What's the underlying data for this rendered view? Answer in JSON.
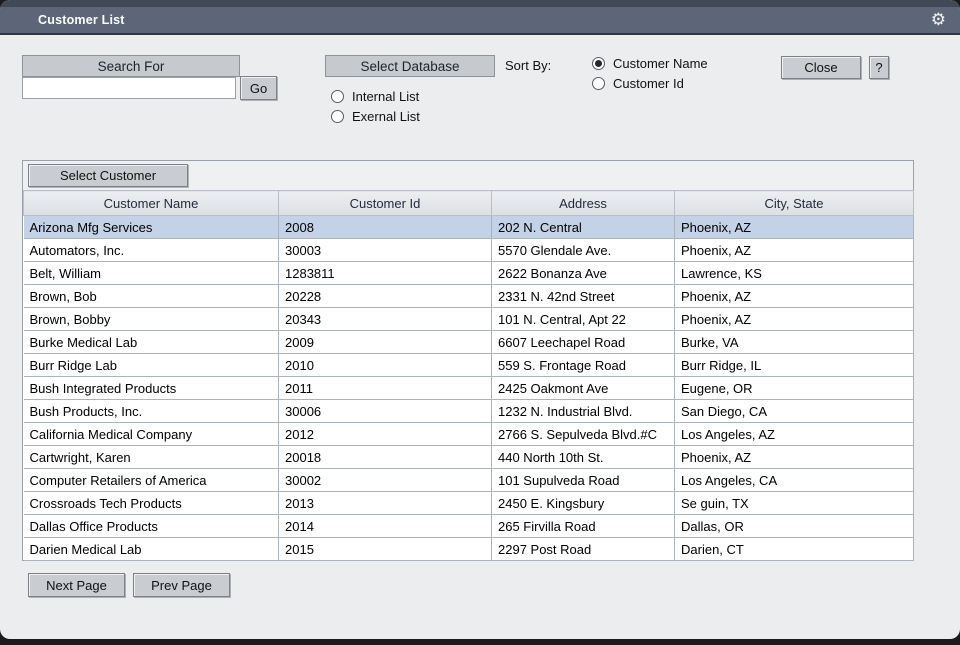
{
  "window": {
    "title": "Customer List"
  },
  "icons": {
    "titlebar_right": "gear-icon",
    "gear_glyph": "⚙"
  },
  "colors": {
    "titlebar": "#5c6678",
    "titlebar_top_strip": "#414956",
    "body_bg": "#ebedef",
    "selected_row": "#c4d2e7",
    "header_bar": "#c6c9cd",
    "outer_bg": "#1b1b1b"
  },
  "search": {
    "header": "Search For",
    "value": "",
    "go_label": "Go"
  },
  "database": {
    "header": "Select Database",
    "options": [
      {
        "label": "Internal List",
        "selected": false
      },
      {
        "label": "Exernal List",
        "selected": false
      }
    ]
  },
  "sort": {
    "label": "Sort By:",
    "options": [
      {
        "label": "Customer Name",
        "selected": true
      },
      {
        "label": "Customer Id",
        "selected": false
      }
    ]
  },
  "actions": {
    "close": "Close",
    "help": "?",
    "select_customer": "Select Customer",
    "next_page": "Next Page",
    "prev_page": "Prev Page"
  },
  "table": {
    "columns": [
      "Customer Name",
      "Customer Id",
      "Address",
      "City, State"
    ],
    "selected_row_index": 0,
    "rows": [
      [
        "Arizona Mfg Services",
        "2008",
        "202 N. Central",
        "Phoenix, AZ"
      ],
      [
        "Automators, Inc.",
        "30003",
        "5570 Glendale Ave.",
        "Phoenix, AZ"
      ],
      [
        "Belt, William",
        "1283811",
        "2622 Bonanza Ave",
        "Lawrence, KS"
      ],
      [
        "Brown, Bob",
        "20228",
        "2331 N. 42nd Street",
        "Phoenix, AZ"
      ],
      [
        "Brown, Bobby",
        "20343",
        "101 N. Central, Apt 22",
        "Phoenix, AZ"
      ],
      [
        "Burke Medical Lab",
        "2009",
        "6607 Leechapel Road",
        "Burke, VA"
      ],
      [
        "Burr Ridge Lab",
        "2010",
        "559 S. Frontage Road",
        "Burr Ridge, IL"
      ],
      [
        "Bush Integrated Products",
        "2011",
        "2425 Oakmont Ave",
        "Eugene, OR"
      ],
      [
        "Bush Products, Inc.",
        "30006",
        "1232 N. Industrial Blvd.",
        "San Diego, CA"
      ],
      [
        "California Medical Company",
        "2012",
        "2766 S. Sepulveda Blvd.#C",
        "Los Angeles, AZ"
      ],
      [
        "Cartwright, Karen",
        "20018",
        "440 North 10th St.",
        "Phoenix, AZ"
      ],
      [
        "Computer Retailers of America",
        "30002",
        "101 Supulveda Road",
        "Los Angeles, CA"
      ],
      [
        "Crossroads Tech Products",
        "2013",
        "2450 E. Kingsbury",
        "Se guin, TX"
      ],
      [
        "Dallas Office Products",
        "2014",
        "265 Firvilla Road",
        "Dallas, OR"
      ],
      [
        "Darien Medical Lab",
        "2015",
        "2297 Post Road",
        "Darien, CT"
      ]
    ]
  }
}
